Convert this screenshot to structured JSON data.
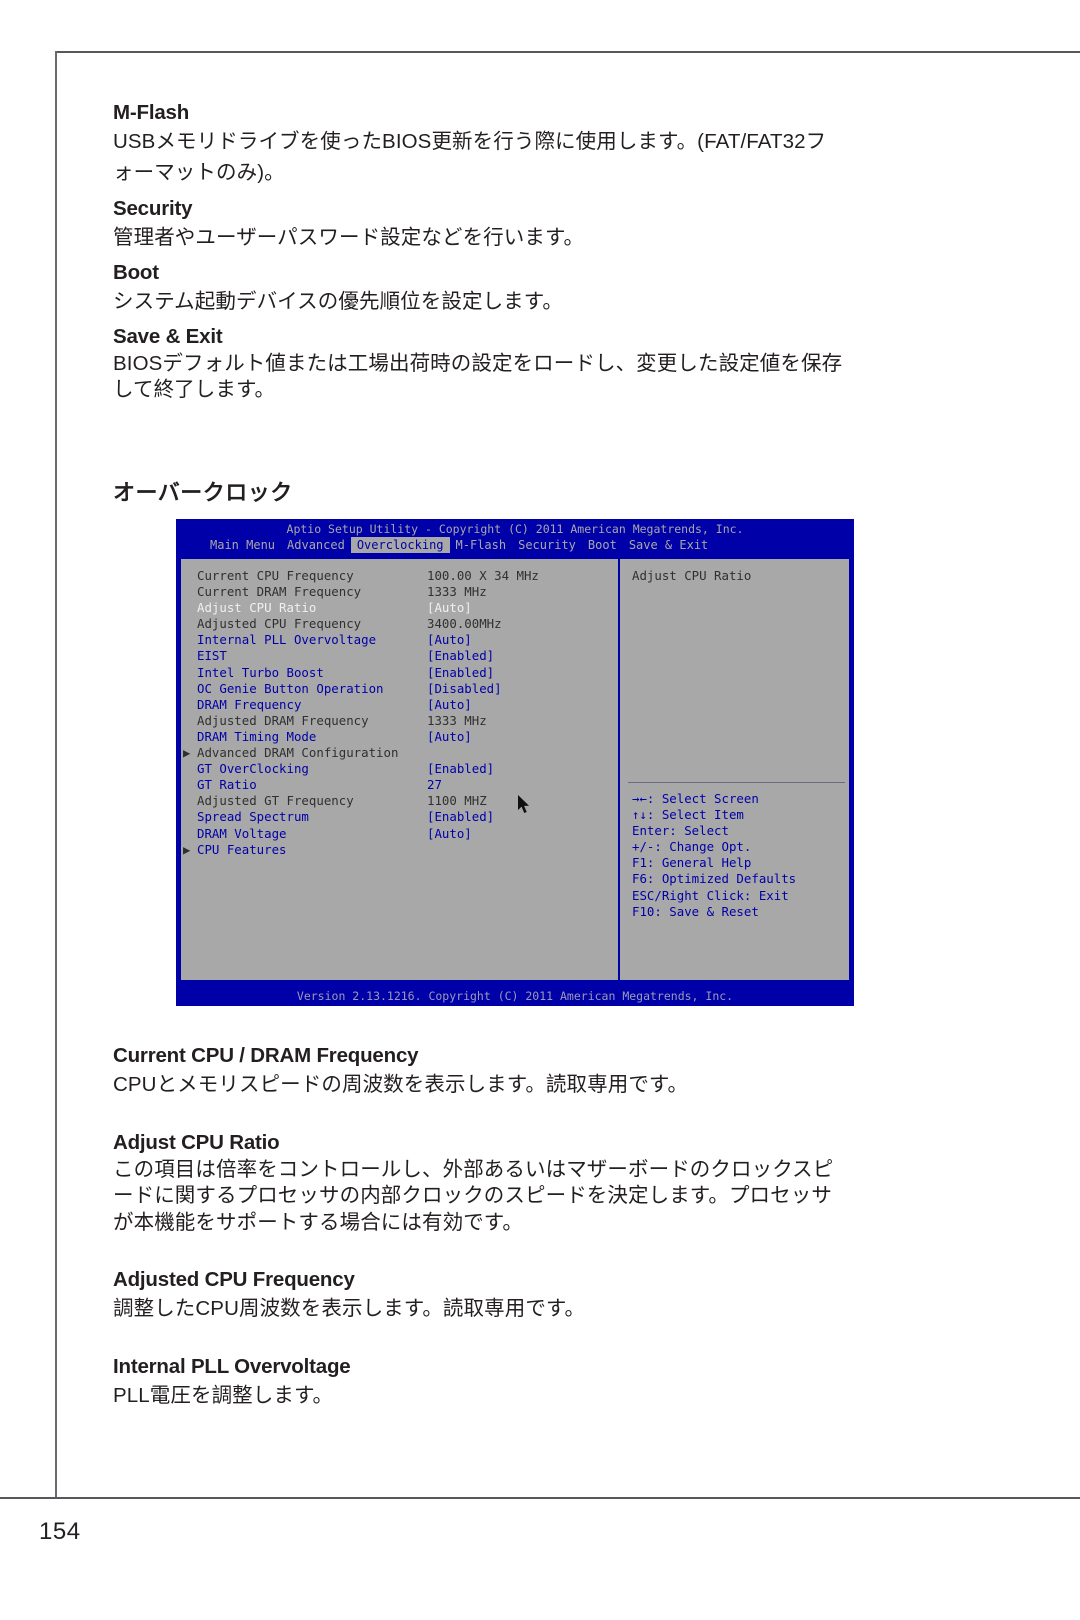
{
  "page": {
    "number": "154"
  },
  "sections": [
    {
      "heading": "M-Flash",
      "body": "USBメモリドライブを使ったBIOS更新を行う際に使用します。(FAT/FAT32フ\nォーマットのみ)。"
    },
    {
      "heading": "Security",
      "body": "管理者やユーザーパスワード設定などを行います。"
    },
    {
      "heading": "Boot",
      "body": "システム起動デバイスの優先順位を設定します。"
    },
    {
      "heading": "Save & Exit",
      "body": "BIOSデフォルト値または工場出荷時の設定をロードし、変更した設定値を保存\nして終了します。"
    }
  ],
  "overclock_section_title": "オーバークロック",
  "bios": {
    "title": "Aptio Setup Utility - Copyright (C) 2011 American Megatrends, Inc.",
    "menu": [
      {
        "label": "Main Menu",
        "active": false
      },
      {
        "label": "Advanced",
        "active": false
      },
      {
        "label": "Overclocking",
        "active": true
      },
      {
        "label": "M-Flash",
        "active": false
      },
      {
        "label": "Security",
        "active": false
      },
      {
        "label": "Boot",
        "active": false
      },
      {
        "label": "Save & Exit",
        "active": false
      }
    ],
    "items": [
      {
        "label": "Current CPU Frequency",
        "value": "100.00 X 34 MHz",
        "style": "ro",
        "submenu": false
      },
      {
        "label": "Current DRAM Frequency",
        "value": "1333 MHz",
        "style": "ro",
        "submenu": false
      },
      {
        "label": "Adjust CPU Ratio",
        "value": "[Auto]",
        "style": "sel",
        "submenu": false
      },
      {
        "label": "Adjusted CPU Frequency",
        "value": "3400.00MHz",
        "style": "ro",
        "submenu": false
      },
      {
        "label": "Internal PLL Overvoltage",
        "value": "[Auto]",
        "style": "opt",
        "submenu": false
      },
      {
        "label": "EIST",
        "value": "[Enabled]",
        "style": "opt",
        "submenu": false
      },
      {
        "label": "Intel Turbo Boost",
        "value": "[Enabled]",
        "style": "opt",
        "submenu": false
      },
      {
        "label": "OC Genie Button Operation",
        "value": "[Disabled]",
        "style": "opt",
        "submenu": false
      },
      {
        "label": "DRAM Frequency",
        "value": "[Auto]",
        "style": "opt",
        "submenu": false
      },
      {
        "label": "Adjusted DRAM Frequency",
        "value": "1333 MHz",
        "style": "ro",
        "submenu": false
      },
      {
        "label": "DRAM Timing Mode",
        "value": "[Auto]",
        "style": "opt",
        "submenu": false
      },
      {
        "label": "Advanced DRAM Configuration",
        "value": "",
        "style": "ro",
        "submenu": true
      },
      {
        "label": "GT OverClocking",
        "value": "[Enabled]",
        "style": "opt",
        "submenu": false
      },
      {
        "label": "GT Ratio",
        "value": "27",
        "style": "opt",
        "submenu": false
      },
      {
        "label": "Adjusted GT Frequency",
        "value": "1100 MHZ",
        "style": "ro",
        "submenu": false
      },
      {
        "label": "Spread Spectrum",
        "value": "[Enabled]",
        "style": "opt",
        "submenu": false
      },
      {
        "label": "DRAM Voltage",
        "value": "[Auto]",
        "style": "opt",
        "submenu": false
      },
      {
        "label": "CPU Features",
        "value": "",
        "style": "opt",
        "submenu": true
      }
    ],
    "help_title": "Adjust CPU Ratio",
    "help_keys": [
      "→←: Select Screen",
      "↑↓: Select Item",
      "Enter: Select",
      "+/-: Change Opt.",
      "F1: General Help",
      "F6: Optimized Defaults",
      "ESC/Right Click: Exit",
      "F10: Save & Reset"
    ],
    "footer": "Version 2.13.1216. Copyright (C) 2011 American Megatrends, Inc.",
    "colors": {
      "background": "#0000a8",
      "panel": "#a8a8a8",
      "readonly_text": "#303030",
      "option_text": "#0000a8",
      "selected_text": "#f0f0f0",
      "title_text": "#a8a8a8"
    }
  },
  "descriptions": [
    {
      "heading": "Current CPU / DRAM Frequency",
      "body": "CPUとメモリスピードの周波数を表示します。読取専用です。"
    },
    {
      "heading": "Adjust CPU Ratio",
      "body": "この項目は倍率をコントロールし、外部あるいはマザーボードのクロックスピ\nードに関するプロセッサの内部クロックのスピードを決定します。プロセッサ\nが本機能をサポートする場合には有効です。"
    },
    {
      "heading": "Adjusted CPU Frequency",
      "body": "調整したCPU周波数を表示します。読取専用です。"
    },
    {
      "heading": "Internal PLL Overvoltage",
      "body": "PLL電圧を調整します。"
    }
  ]
}
